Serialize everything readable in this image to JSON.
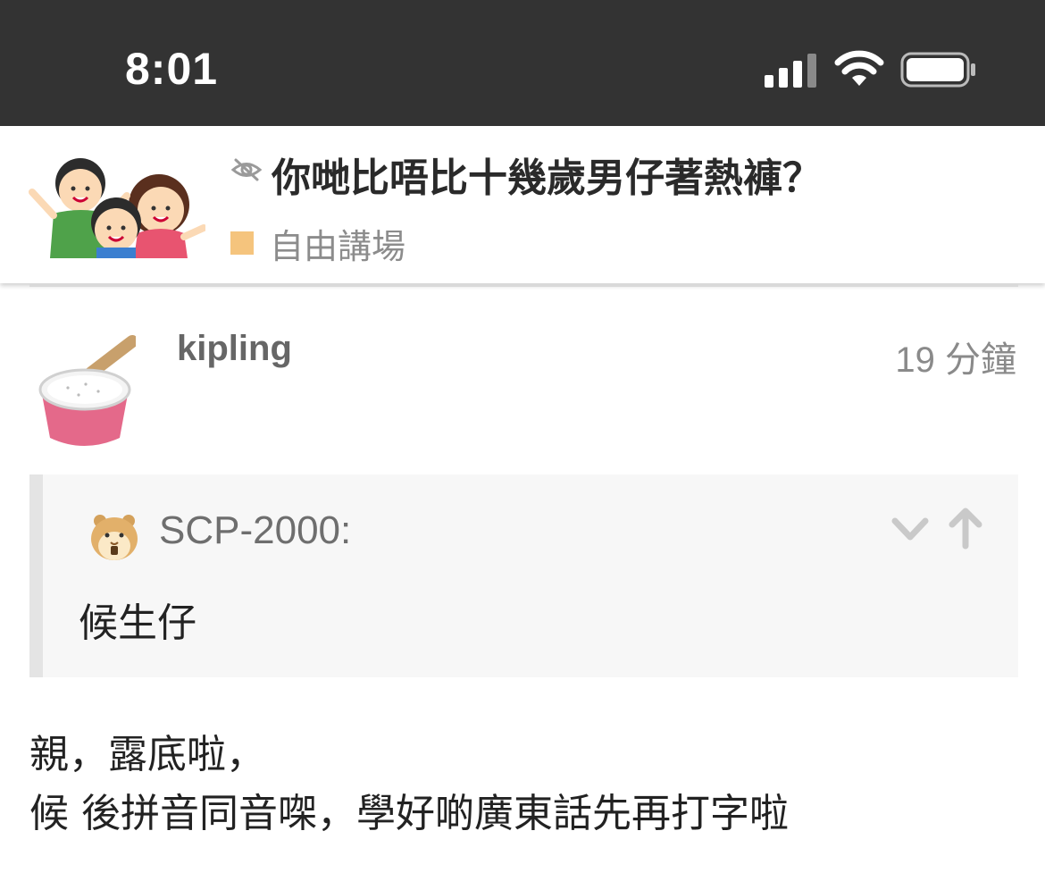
{
  "status_bar": {
    "time": "8:01"
  },
  "thread": {
    "title": "你哋比唔比十幾歲男仔著熱褲？",
    "category": "自由講場",
    "category_color": "#f5c47d"
  },
  "post": {
    "username": "kipling",
    "time_ago": "19 分鐘",
    "quote": {
      "username": "SCP-2000:",
      "text": "候生仔"
    },
    "body_lines": [
      "親，露底啦，",
      "候 後拼音同音㗎，學好啲廣東話先再打字啦"
    ]
  },
  "icons": {
    "status": [
      "signal-icon",
      "wifi-icon",
      "battery-icon"
    ],
    "thread": [
      "hidden-eye-icon",
      "thread-avatar-icon"
    ],
    "quote": [
      "collapse-chevron-icon",
      "scroll-up-arrow-icon"
    ]
  }
}
